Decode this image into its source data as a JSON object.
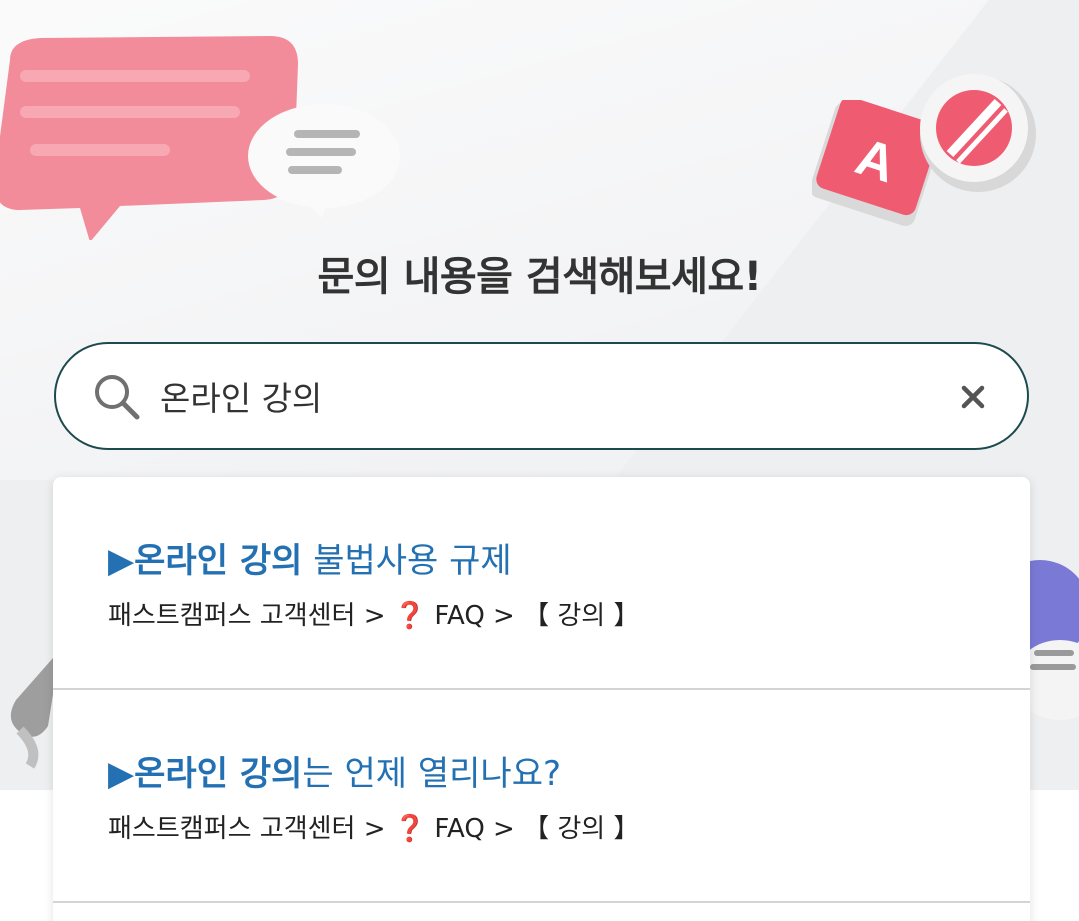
{
  "page_title": "문의 내용을 검색해보세요!",
  "search": {
    "value": "온라인 강의",
    "placeholder": ""
  },
  "results": [
    {
      "arrow": "▶",
      "highlight": "온라인 강의",
      "rest": " 불법사용 규제",
      "path_prefix": "패스트캠퍼스 고객센터 > ",
      "path_icon": "❓",
      "path_suffix": " FAQ > 【 강의 】"
    },
    {
      "arrow": "▶",
      "highlight": "온라인 강의",
      "rest": "는 언제 열리나요?",
      "path_prefix": "패스트캠퍼스 고객센터 > ",
      "path_icon": "❓",
      "path_suffix": " FAQ > 【 강의 】"
    }
  ],
  "colors": {
    "accent": "#2371b2",
    "search_border": "#1c4a4e",
    "question_mark": "#d6202a",
    "hero_bg": "#eeeff1"
  },
  "icons": [
    "search-icon",
    "close-icon",
    "speech-bubble-icon",
    "letter-a-block-icon",
    "no-sign-ball-icon"
  ],
  "hero_letter": "A"
}
